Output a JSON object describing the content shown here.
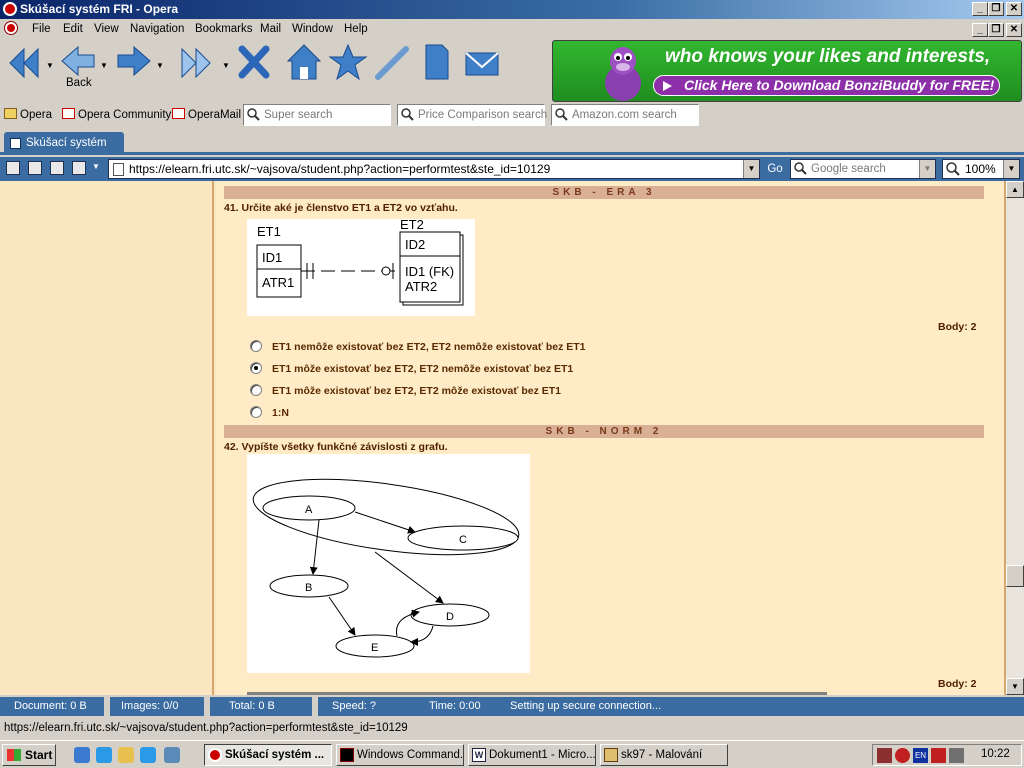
{
  "window": {
    "title": "Skúšací systém FRI - Opera"
  },
  "menu": [
    "File",
    "Edit",
    "View",
    "Navigation",
    "Bookmarks",
    "Mail",
    "Window",
    "Help"
  ],
  "toolbar": {
    "back_label": "Back"
  },
  "banner": {
    "line1": "who knows your likes and interests,",
    "line2": "Click Here to Download BonziBuddy for FREE!"
  },
  "personal_bar": {
    "items": [
      "Opera",
      "Opera Community",
      "OperaMail"
    ],
    "searches": [
      "Super search",
      "Price Comparison search",
      "Amazon.com search"
    ]
  },
  "tabs": [
    {
      "label": "Skúšací systém FRI"
    }
  ],
  "address": {
    "url": "https://elearn.fri.utc.sk/~vajsova/student.php?action=performtest&ste_id=10129",
    "go": "Go",
    "search_placeholder": "Google search",
    "zoom": "100%"
  },
  "questions": [
    {
      "section": "SKB - ERA 3",
      "title": "41. Určite aké je členstvo ET1 a ET2 vo vzťahu.",
      "diagram": {
        "et1": "ET1",
        "et1_id": "ID1",
        "et1_attr": "ATR1",
        "et2": "ET2",
        "et2_id": "ID2",
        "et2_fk": "ID1 (FK)",
        "et2_attr": "ATR2"
      },
      "points": "Body: 2",
      "options": [
        "ET1 nemôže existovať bez ET2, ET2 nemôže existovať bez ET1",
        "ET1 môže existovať bez ET2, ET2 nemôže existovať bez ET1",
        "ET1 môže existovať bez ET2, ET2 môže existovať bez ET1",
        "1:N"
      ],
      "selected_option": 1
    },
    {
      "section": "SKB - NORM 2",
      "title": "42. Vypíšte všetky funkčné závislosti z grafu.",
      "graph_nodes": [
        "A",
        "B",
        "C",
        "D",
        "E"
      ],
      "points": "Body: 2"
    }
  ],
  "status": {
    "document": "Document:  0 B",
    "images": "Images:  0/0",
    "total": "Total:  0 B",
    "speed": "Speed:  ?",
    "time": "Time:  0:00",
    "message": "Setting up secure connection..."
  },
  "hover_url": "https://elearn.fri.utc.sk/~vajsova/student.php?action=performtest&ste_id=10129",
  "taskbar": {
    "start": "Start",
    "tasks": [
      "Skúšací systém ...",
      "Windows Command...",
      "Dokument1 - Micro...",
      "sk97 - Malování"
    ],
    "tray_lang": "EN",
    "clock": "10:22"
  },
  "colors": {
    "accent": "#3b6ca1",
    "page_bg": "#ffebc6",
    "section_bar": "#d9b096",
    "question_text": "#502000"
  }
}
